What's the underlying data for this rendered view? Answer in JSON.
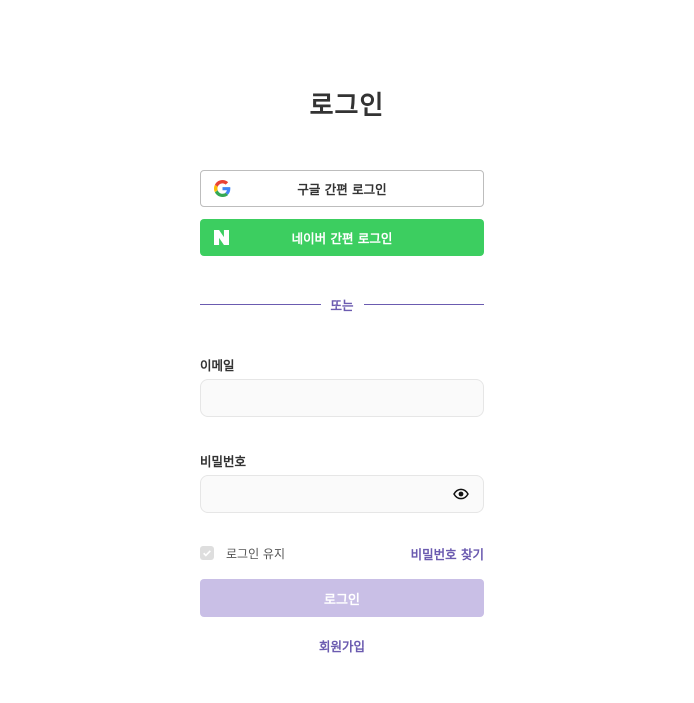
{
  "page": {
    "title": "로그인"
  },
  "social": {
    "google_label": "구글 간편 로그인",
    "naver_label": "네이버 간편 로그인"
  },
  "divider": {
    "text": "또는"
  },
  "form": {
    "email_label": "이메일",
    "email_value": "",
    "password_label": "비밀번호",
    "password_value": "",
    "remember_label": "로그인 유지",
    "remember_checked": true,
    "find_password_label": "비밀번호 찾기",
    "submit_label": "로그인"
  },
  "footer": {
    "signup_label": "회원가입"
  },
  "colors": {
    "accent": "#6b5bb0",
    "naver_green": "#3cce60",
    "login_disabled": "#c9bfe6"
  },
  "icons": {
    "google": "google-logo-icon",
    "naver": "naver-logo-icon",
    "visibility": "eye-icon",
    "checkbox": "check-icon"
  }
}
